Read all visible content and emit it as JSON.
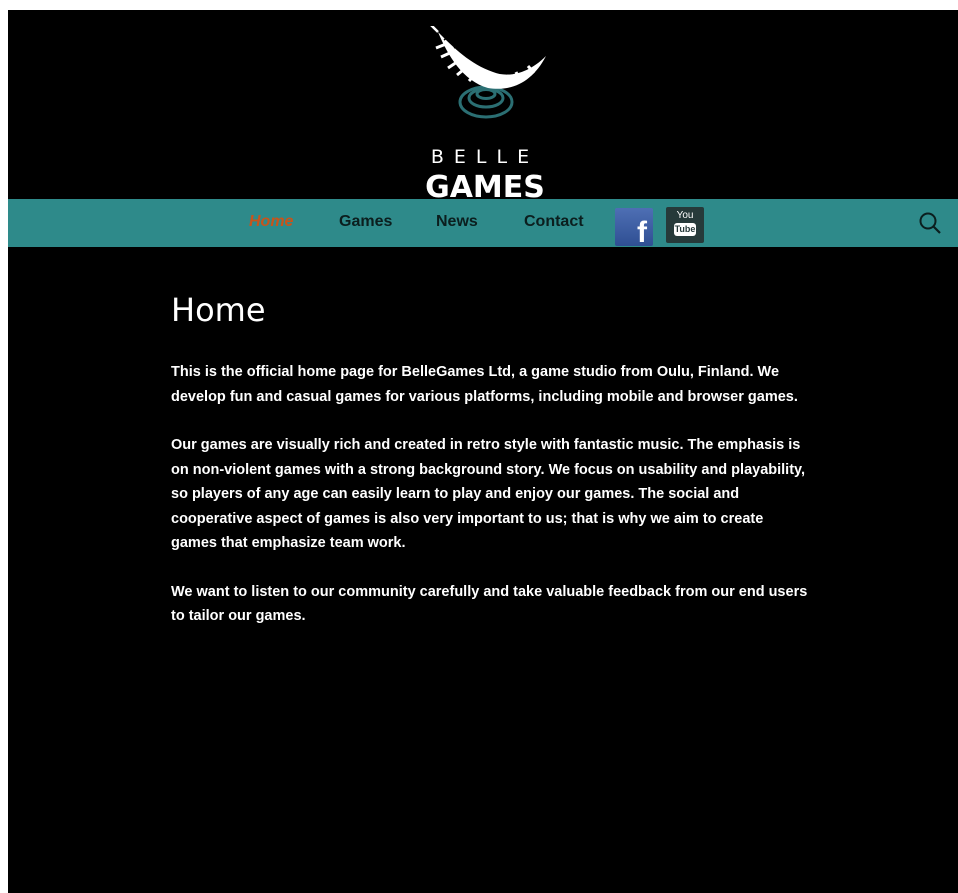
{
  "site": {
    "logo": {
      "line1": "BELLE",
      "line2": "GAMES"
    }
  },
  "nav": {
    "items": [
      {
        "label": "Home",
        "active": true
      },
      {
        "label": "Games",
        "active": false
      },
      {
        "label": "News",
        "active": false
      },
      {
        "label": "Contact",
        "active": false
      }
    ],
    "social": [
      {
        "name": "facebook",
        "icon": "facebook-icon",
        "glyph": "f"
      },
      {
        "name": "youtube",
        "icon": "youtube-icon",
        "glyph_top": "You",
        "glyph_bottom": "Tube"
      }
    ],
    "search_icon": "search-icon"
  },
  "main": {
    "title": "Home",
    "paragraphs": [
      "This is the official home page for BelleGames Ltd, a game studio from Oulu, Finland. We develop fun and casual games for various platforms, including mobile and browser games.",
      "Our games are visually rich and created in retro style with fantastic music. The emphasis is on non-violent games with a strong background story. We focus on usability and playability, so players of any age can easily learn to play and enjoy our games. The social and cooperative aspect of games is also very important to us; that is why we aim to create games that emphasize team work.",
      "We want to listen to our community carefully and take valuable feedback from our end users to tailor our games."
    ]
  },
  "colors": {
    "background": "#000000",
    "navbar": "#2e8a8a",
    "nav_active": "#c8541a",
    "nav_text": "#0b1e1e",
    "text": "#ffffff",
    "logo_ripple": "#2b6f73"
  }
}
